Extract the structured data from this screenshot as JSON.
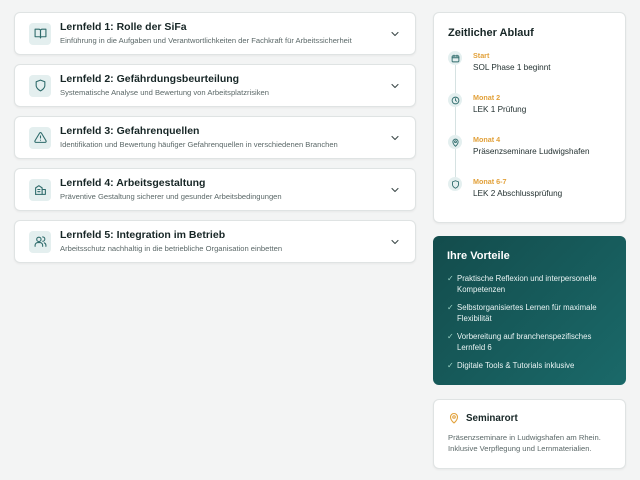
{
  "lernfelder": [
    {
      "title": "Lernfeld 1: Rolle der SiFa",
      "subtitle": "Einführung in die Aufgaben und Verantwortlichkeiten der Fachkraft für Arbeitssicherheit",
      "icon": "book-icon"
    },
    {
      "title": "Lernfeld 2: Gefährdungsbeurteilung",
      "subtitle": "Systematische Analyse und Bewertung von Arbeitsplatzrisiken",
      "icon": "shield-icon"
    },
    {
      "title": "Lernfeld 3: Gefahrenquellen",
      "subtitle": "Identifikation und Bewertung häufiger Gefahrenquellen in verschiedenen Branchen",
      "icon": "warning-icon"
    },
    {
      "title": "Lernfeld 4: Arbeitsgestaltung",
      "subtitle": "Präventive Gestaltung sicherer und gesunder Arbeitsbedingungen",
      "icon": "building-icon"
    },
    {
      "title": "Lernfeld 5: Integration im Betrieb",
      "subtitle": "Arbeitsschutz nachhaltig in die betriebliche Organisation einbetten",
      "icon": "users-icon"
    }
  ],
  "timeline": {
    "title": "Zeitlicher Ablauf",
    "items": [
      {
        "label": "Start",
        "value": "SOL Phase 1 beginnt",
        "icon": "calendar-icon"
      },
      {
        "label": "Monat 2",
        "value": "LEK 1 Prüfung",
        "icon": "clock-icon"
      },
      {
        "label": "Monat 4",
        "value": "Präsenzseminare Ludwigshafen",
        "icon": "location-pin-icon"
      },
      {
        "label": "Monat 6-7",
        "value": "LEK 2 Abschlussprüfung",
        "icon": "shield-icon"
      }
    ]
  },
  "vorteile": {
    "title": "Ihre Vorteile",
    "items": [
      "Praktische Reflexion und interpersonelle Kompetenzen",
      "Selbstorganisiertes Lernen für maximale Flexibilität",
      "Vorbereitung auf branchenspezifisches Lernfeld 6",
      "Digitale Tools & Tutorials inklusive"
    ]
  },
  "seminarort": {
    "title": "Seminarort",
    "text": "Präsenzseminare in Ludwigshafen am Rhein. Inklusive Verpflegung und Lernmaterialien."
  },
  "colors": {
    "accent": "#e2a13a",
    "teal_dark": "#134c4c",
    "teal_light": "#1a6969",
    "icon_bg": "#e4efef"
  }
}
